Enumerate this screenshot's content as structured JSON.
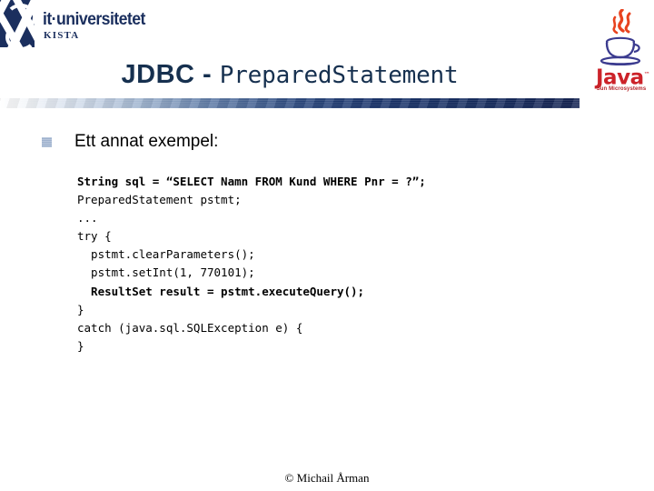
{
  "branding": {
    "university": {
      "wordmark": "it·universitetet",
      "campus": "KISTA",
      "mark_color": "#1b2f5e"
    },
    "java": {
      "word": "Java",
      "tm": "™",
      "sun": "Sun Microsystems",
      "word_color": "#cc2229"
    }
  },
  "title": {
    "main": "JDBC - ",
    "mono": "PreparedStatement",
    "color": "#16304f"
  },
  "divider": {
    "start_color": "#ffffff",
    "end_color": "#101f4f"
  },
  "bullet": {
    "text": "Ett annat exempel:",
    "marker_color": "#a8bad3"
  },
  "code": {
    "lines": [
      {
        "text": "String sql = “SELECT Namn FROM Kund WHERE Pnr = ?”;",
        "bold": true
      },
      {
        "text": "PreparedStatement pstmt;",
        "bold": false
      },
      {
        "text": "...",
        "bold": false
      },
      {
        "text": "try {",
        "bold": false
      },
      {
        "text": "  pstmt.clearParameters();",
        "bold": false
      },
      {
        "text": "  pstmt.setInt(1, 770101);",
        "bold": false
      },
      {
        "text": "  ResultSet result = pstmt.executeQuery();",
        "bold": true
      },
      {
        "text": "}",
        "bold": false
      },
      {
        "text": "catch (java.sql.SQLException e) {",
        "bold": false
      },
      {
        "text": "}",
        "bold": false
      }
    ]
  },
  "footer": {
    "copyright": "© Michail Årman"
  }
}
